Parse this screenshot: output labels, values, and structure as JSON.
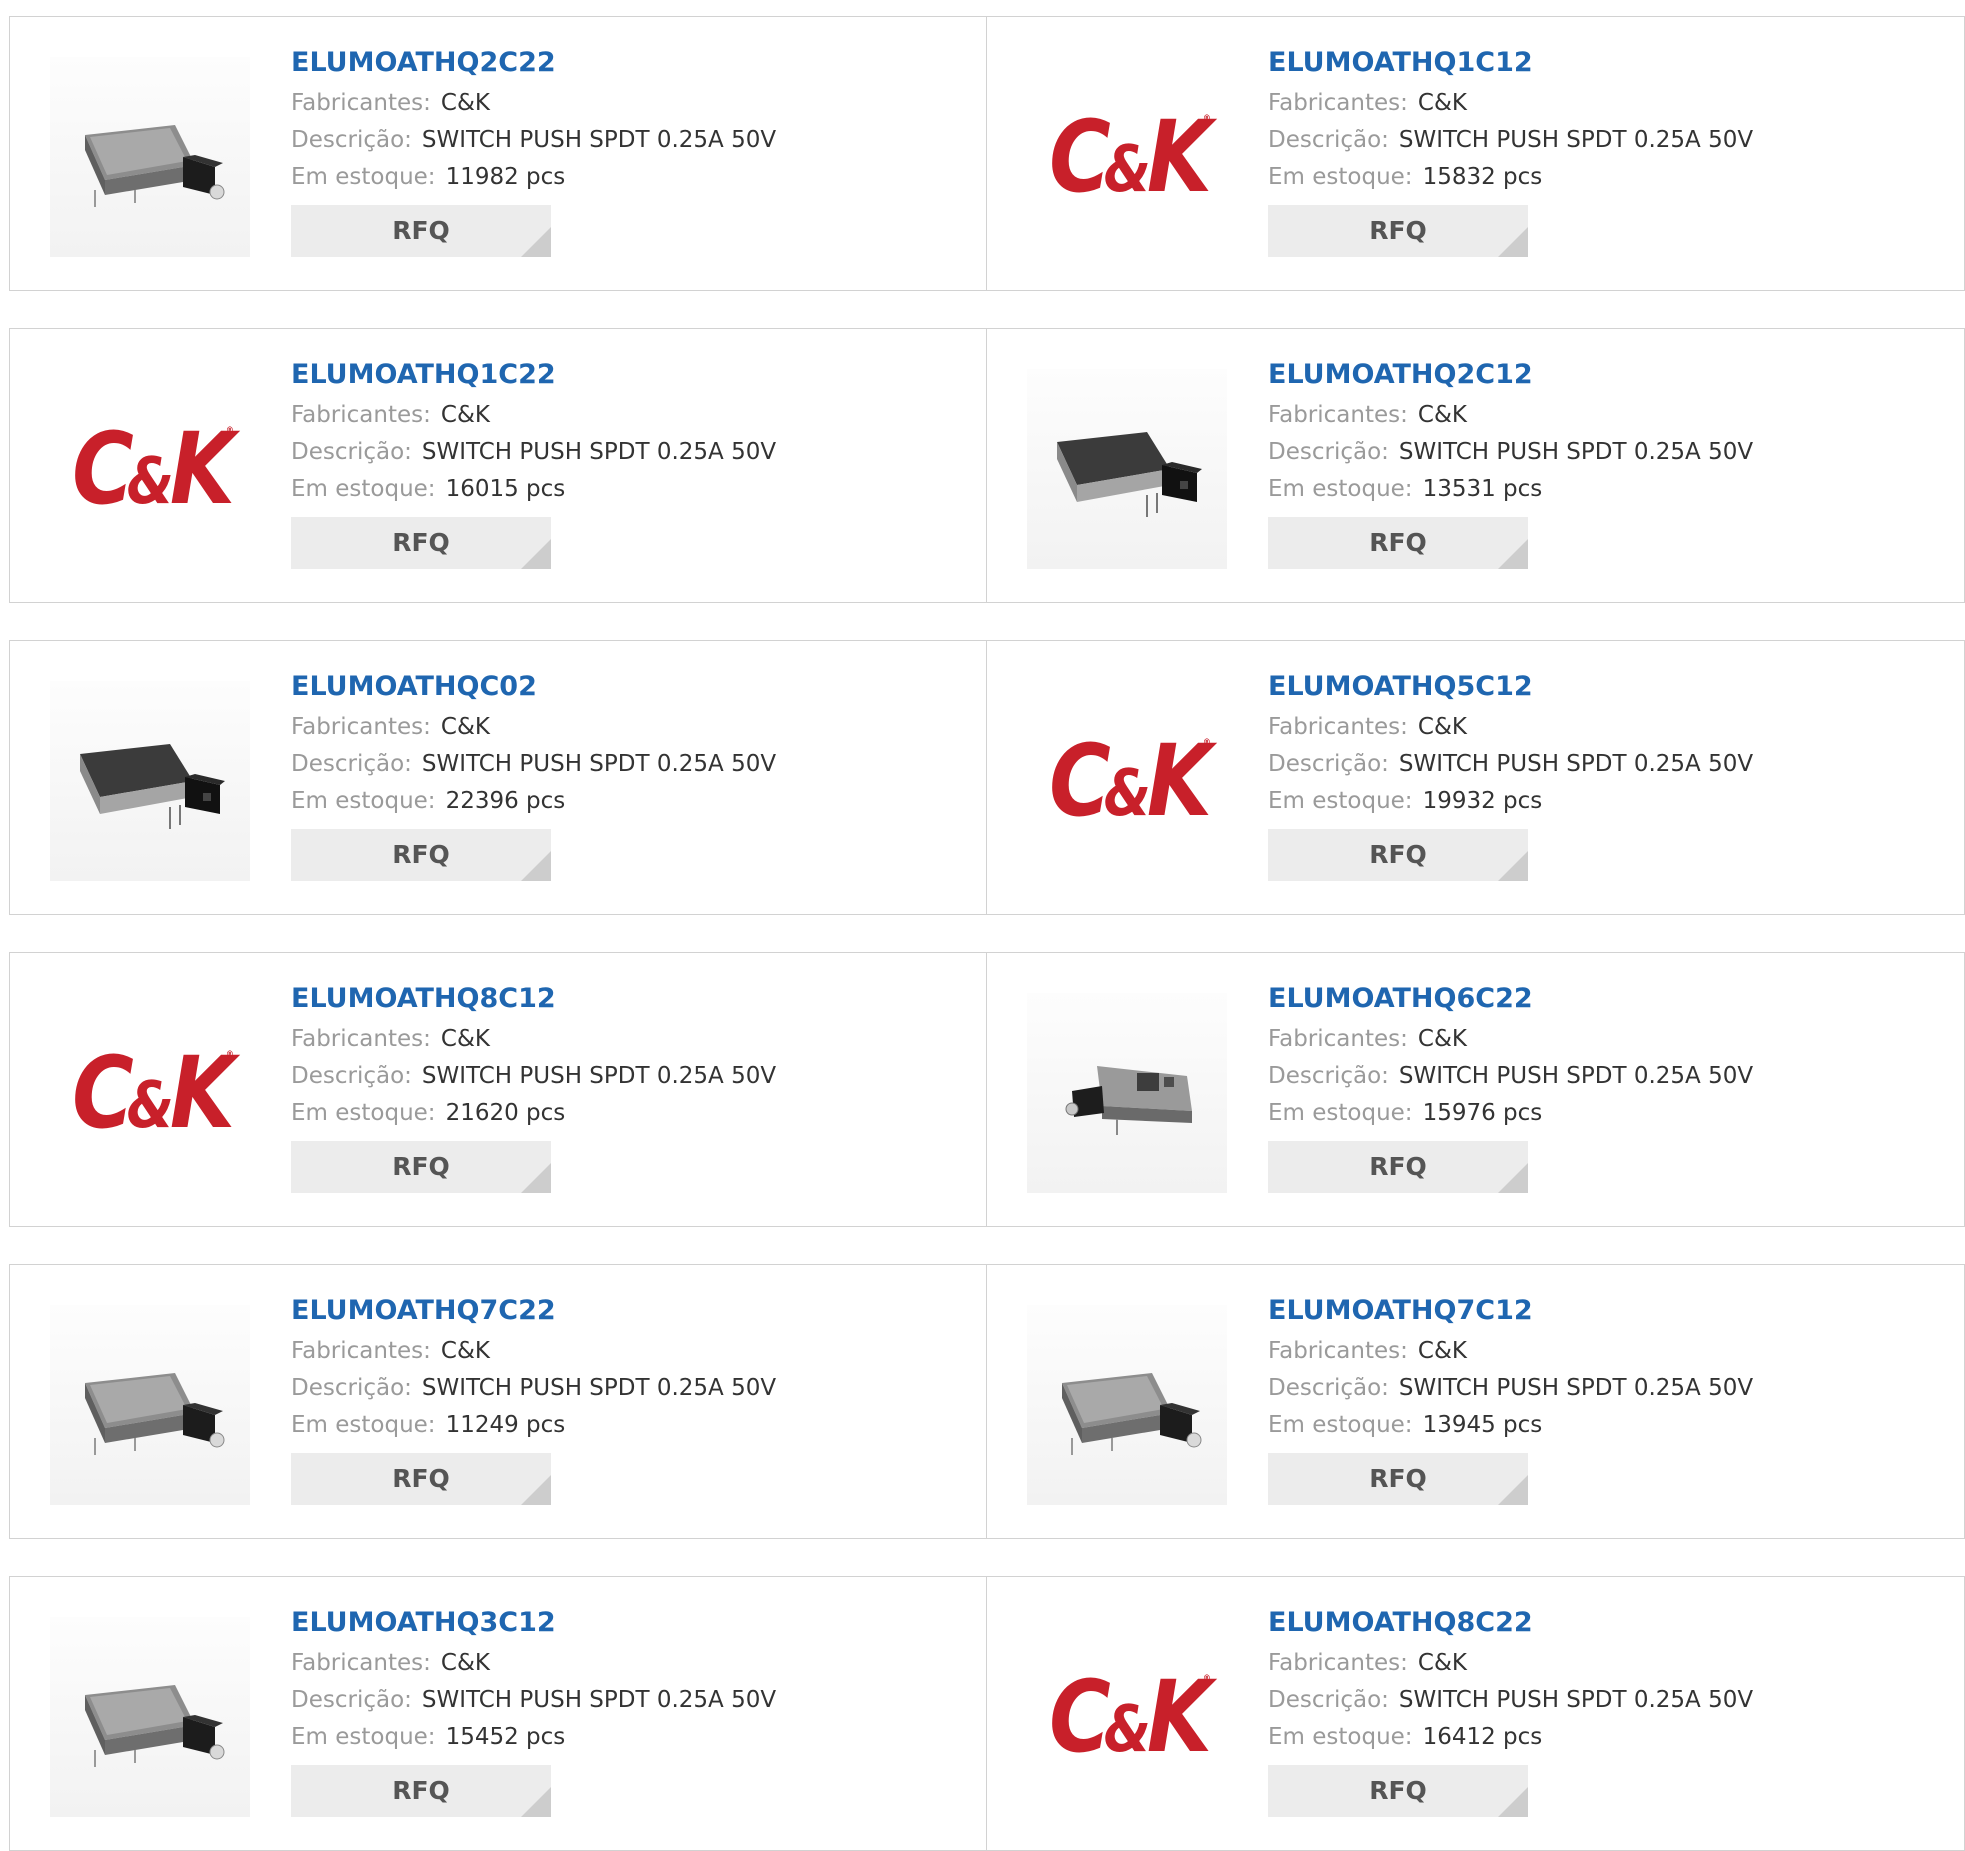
{
  "labels": {
    "manufacturer": "Fabricantes:",
    "description": "Descrição:",
    "stock": "Em estoque:",
    "rfq": "RFQ"
  },
  "logo": {
    "text_main": "C",
    "text_amp": "&",
    "text_end": "K",
    "reg": "®",
    "color": "#c8202a"
  },
  "link_color": "#1f66b0",
  "products": [
    {
      "part": "ELUMOATHQ2C22",
      "manufacturer": "C&K",
      "description": "SWITCH PUSH SPDT 0.25A 50V",
      "stock": "11982 pcs",
      "image": "switch-photo"
    },
    {
      "part": "ELUMOATHQ1C12",
      "manufacturer": "C&K",
      "description": "SWITCH PUSH SPDT 0.25A 50V",
      "stock": "15832 pcs",
      "image": "ck-logo"
    },
    {
      "part": "ELUMOATHQ1C22",
      "manufacturer": "C&K",
      "description": "SWITCH PUSH SPDT 0.25A 50V",
      "stock": "16015 pcs",
      "image": "ck-logo"
    },
    {
      "part": "ELUMOATHQ2C12",
      "manufacturer": "C&K",
      "description": "SWITCH PUSH SPDT 0.25A 50V",
      "stock": "13531 pcs",
      "image": "switch-photo-dark"
    },
    {
      "part": "ELUMOATHQC02",
      "manufacturer": "C&K",
      "description": "SWITCH PUSH SPDT 0.25A 50V",
      "stock": "22396 pcs",
      "image": "switch-photo-dark"
    },
    {
      "part": "ELUMOATHQ5C12",
      "manufacturer": "C&K",
      "description": "SWITCH PUSH SPDT 0.25A 50V",
      "stock": "19932 pcs",
      "image": "ck-logo"
    },
    {
      "part": "ELUMOATHQ8C12",
      "manufacturer": "C&K",
      "description": "SWITCH PUSH SPDT 0.25A 50V",
      "stock": "21620 pcs",
      "image": "ck-logo"
    },
    {
      "part": "ELUMOATHQ6C22",
      "manufacturer": "C&K",
      "description": "SWITCH PUSH SPDT 0.25A 50V",
      "stock": "15976 pcs",
      "image": "switch-photo-flipped"
    },
    {
      "part": "ELUMOATHQ7C22",
      "manufacturer": "C&K",
      "description": "SWITCH PUSH SPDT 0.25A 50V",
      "stock": "11249 pcs",
      "image": "switch-photo"
    },
    {
      "part": "ELUMOATHQ7C12",
      "manufacturer": "C&K",
      "description": "SWITCH PUSH SPDT 0.25A 50V",
      "stock": "13945 pcs",
      "image": "switch-photo"
    },
    {
      "part": "ELUMOATHQ3C12",
      "manufacturer": "C&K",
      "description": "SWITCH PUSH SPDT 0.25A 50V",
      "stock": "15452 pcs",
      "image": "switch-photo"
    },
    {
      "part": "ELUMOATHQ8C22",
      "manufacturer": "C&K",
      "description": "SWITCH PUSH SPDT 0.25A 50V",
      "stock": "16412 pcs",
      "image": "ck-logo"
    }
  ]
}
